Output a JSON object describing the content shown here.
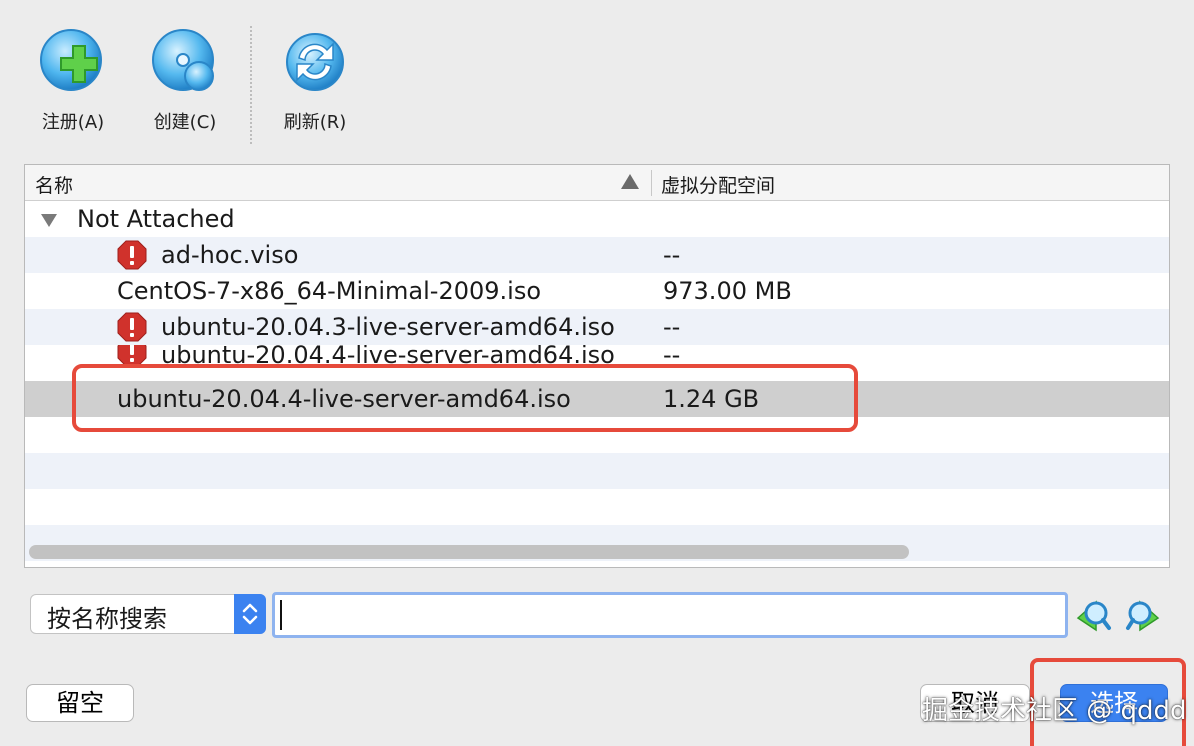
{
  "toolbar": {
    "register_label": "注册(A)",
    "create_label": "创建(C)",
    "refresh_label": "刷新(R)"
  },
  "table": {
    "columns": [
      "名称",
      "虚拟分配空间"
    ],
    "group_label": "Not Attached",
    "rows": [
      {
        "name": "ad-hoc.viso",
        "size": "--",
        "error": true
      },
      {
        "name": "CentOS-7-x86_64-Minimal-2009.iso",
        "size": "973.00 MB",
        "error": false
      },
      {
        "name": "ubuntu-20.04.3-live-server-amd64.iso",
        "size": "--",
        "error": true
      },
      {
        "name": "ubuntu-20.04.4-live-server-amd64.iso",
        "size": "--",
        "error": true
      },
      {
        "name": "ubuntu-20.04.4-live-server-amd64.iso",
        "size": "1.24 GB",
        "error": false,
        "selected": true
      }
    ]
  },
  "search": {
    "mode_selected": "按名称搜索",
    "query": ""
  },
  "buttons": {
    "empty_label": "留空",
    "cancel_label": "取消",
    "choose_label": "选择"
  },
  "watermark": "掘金技术社区 @ qddd",
  "colors": {
    "accent": "#3b82f0",
    "highlight": "#e64a3b",
    "selected_row": "#cfcfcf",
    "alt_row": "#eef2f9",
    "error": "#d0322c"
  }
}
